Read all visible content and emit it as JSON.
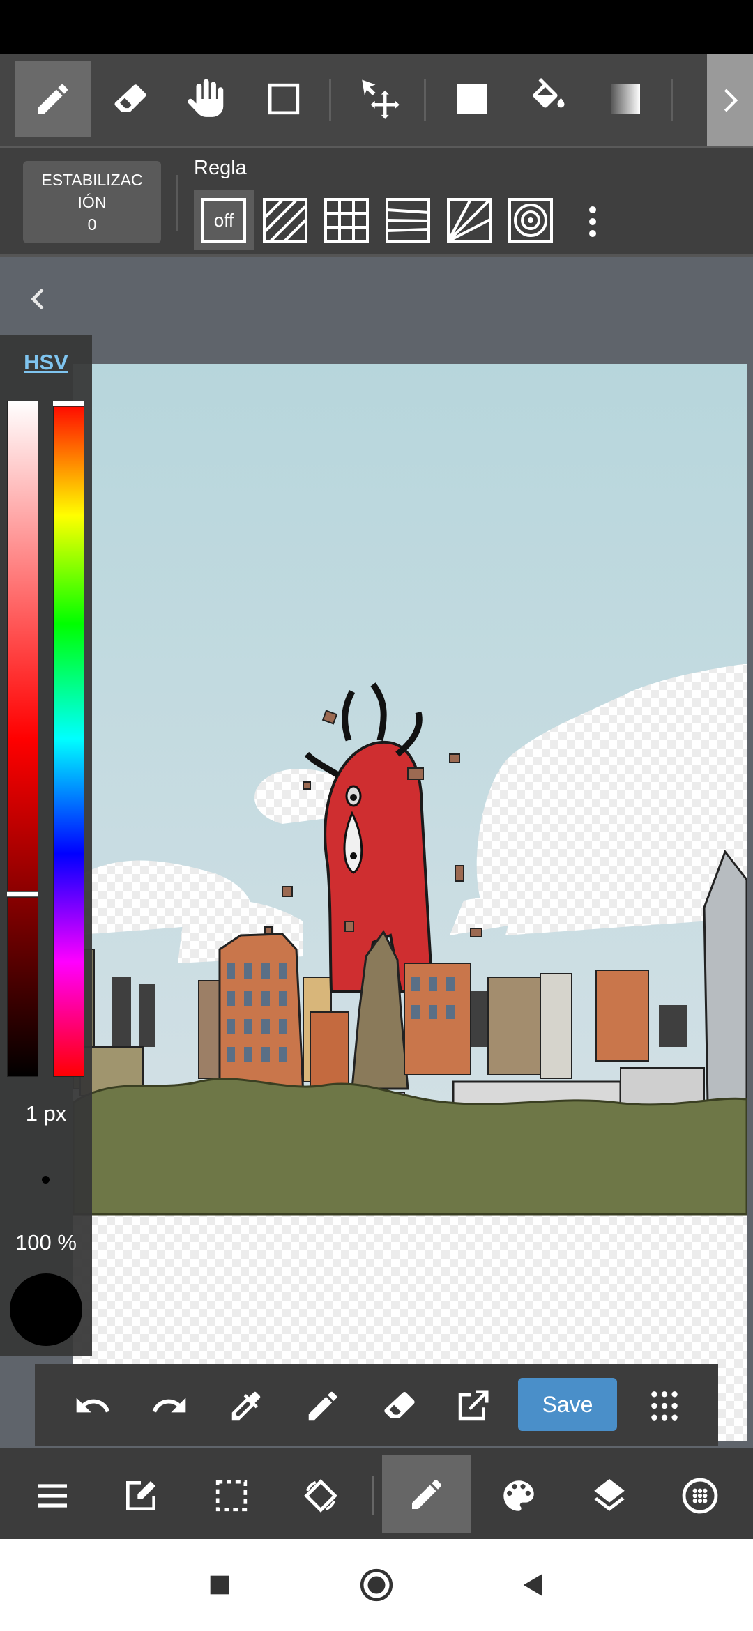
{
  "toolbar": {
    "tools": [
      {
        "icon": "pen-icon",
        "active": true
      },
      {
        "icon": "eraser-icon"
      },
      {
        "icon": "hand-icon"
      },
      {
        "icon": "rectangle-select-icon"
      },
      {
        "icon": "move-icon"
      },
      {
        "icon": "fill-shape-icon"
      },
      {
        "icon": "bucket-icon"
      },
      {
        "icon": "gradient-icon"
      }
    ],
    "more_icon": "chevron-right-icon"
  },
  "stabilizer": {
    "label_line1": "ESTABILIZAC",
    "label_line2": "IÓN",
    "value": "0"
  },
  "ruler": {
    "label": "Regla",
    "off_label": "off",
    "options": [
      "parallel-ruler-icon",
      "grid-ruler-icon",
      "perspective-ruler-icon",
      "radial-ruler-icon",
      "concentric-ruler-icon"
    ],
    "menu_icon": "more-vert-icon"
  },
  "color_panel": {
    "mode_label": "HSV",
    "brush_size": "1 px",
    "opacity": "100 %",
    "current_color": "#000000",
    "brightness": 0.73,
    "hue": 0.0
  },
  "actions": {
    "save_label": "Save"
  },
  "bottom_nav": {
    "items": [
      "menu-icon",
      "edit-icon",
      "selection-icon",
      "rotate-canvas-icon",
      "brush-icon",
      "palette-icon",
      "layers-icon",
      "material-icon"
    ],
    "active": "brush-icon"
  },
  "colors": {
    "accent": "#4a8fc9",
    "toolbar": "#454545",
    "monster": "#cf2e30"
  }
}
